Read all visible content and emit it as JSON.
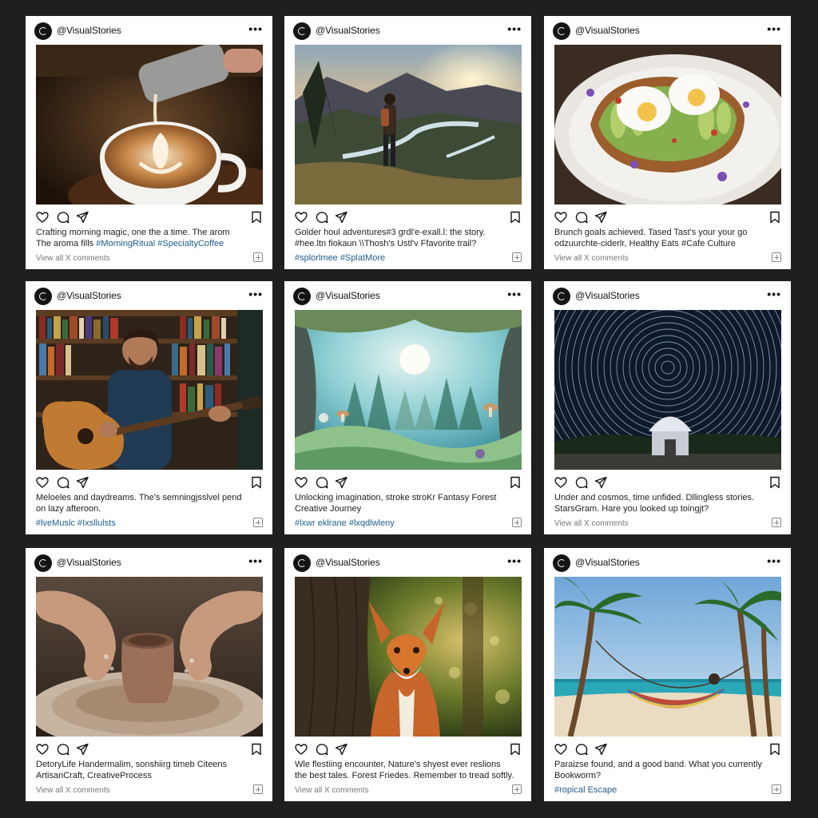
{
  "username": "@VisualStories",
  "more_label": "•••",
  "posts": [
    {
      "subject": "latte art coffee pour",
      "caption_lines": [
        "Crafting morning magic, one the a time. The arom"
      ],
      "caption_mixed": {
        "text": "The aroma fills ",
        "tags": "#MorningRitual #SpecialtyCoffee"
      },
      "footer": {
        "type": "comments",
        "text": "View all X comments"
      }
    },
    {
      "subject": "hiker overlooking river valley at sunset",
      "caption_lines": [
        "Golder houl adventures#3 grdl'e-exall.l: the story.",
        "#hee.ltn fiokaun  \\\\Thosh's Ustl'v Ffavorite trail?"
      ],
      "caption_mixed": null,
      "footer": {
        "type": "tags",
        "text": "#splorlmee #SplatMore"
      }
    },
    {
      "subject": "avocado toast with poached eggs",
      "caption_lines": [
        "Brunch goals achieved. Tased Tast's your your go",
        "odzuurchte-ciderlr, Healthy Eats #Cafe Culture"
      ],
      "caption_mixed": null,
      "footer": {
        "type": "comments",
        "text": "View all X comments"
      }
    },
    {
      "subject": "man playing acoustic guitar by bookshelf",
      "caption_lines": [
        "Meloeles and daydreams. The's semningjsslvel pend",
        "on lazy afteroon."
      ],
      "caption_mixed": null,
      "footer": {
        "type": "tags",
        "text": "#lveMuslc #Ixsllulsts"
      }
    },
    {
      "subject": "illustrated fantasy forest",
      "caption_lines": [
        "Unlocking imagination, stroke stroKr Fantasy Forest",
        "Creative Journey"
      ],
      "caption_mixed": null,
      "footer": {
        "type": "tags",
        "text": "#lxwr eklrane #lxqdlwleny"
      }
    },
    {
      "subject": "star trails over observatory",
      "caption_lines": [
        "Under and cosmos, time unfided. Dllingless stories.",
        "StarsGram. Hare you looked up toingjt?"
      ],
      "caption_mixed": null,
      "footer": {
        "type": "comments",
        "text": "View all X comments"
      }
    },
    {
      "subject": "hands shaping clay on pottery wheel",
      "caption_lines": [
        "DetoryLife Handermalim, sonshiirg timeb Citeens",
        "ArtisanCraft, CreativeProcess"
      ],
      "caption_mixed": null,
      "footer": {
        "type": "comments",
        "text": "View all X comments"
      }
    },
    {
      "subject": "red fox in sunlit forest",
      "caption_lines": [
        "Wle flestiing encounter, Nature's shyest ever reslions",
        "the best tales. Forest Friedes. Remember to tread softly."
      ],
      "caption_mixed": null,
      "footer": {
        "type": "comments",
        "text": "View all X comments"
      }
    },
    {
      "subject": "hammock between palm trees on beach",
      "caption_lines": [
        "Paraizse found, and a good band. What you currently",
        "Bookworm?"
      ],
      "caption_mixed": null,
      "footer": {
        "type": "tags",
        "text": "#ropical Escape"
      }
    }
  ]
}
